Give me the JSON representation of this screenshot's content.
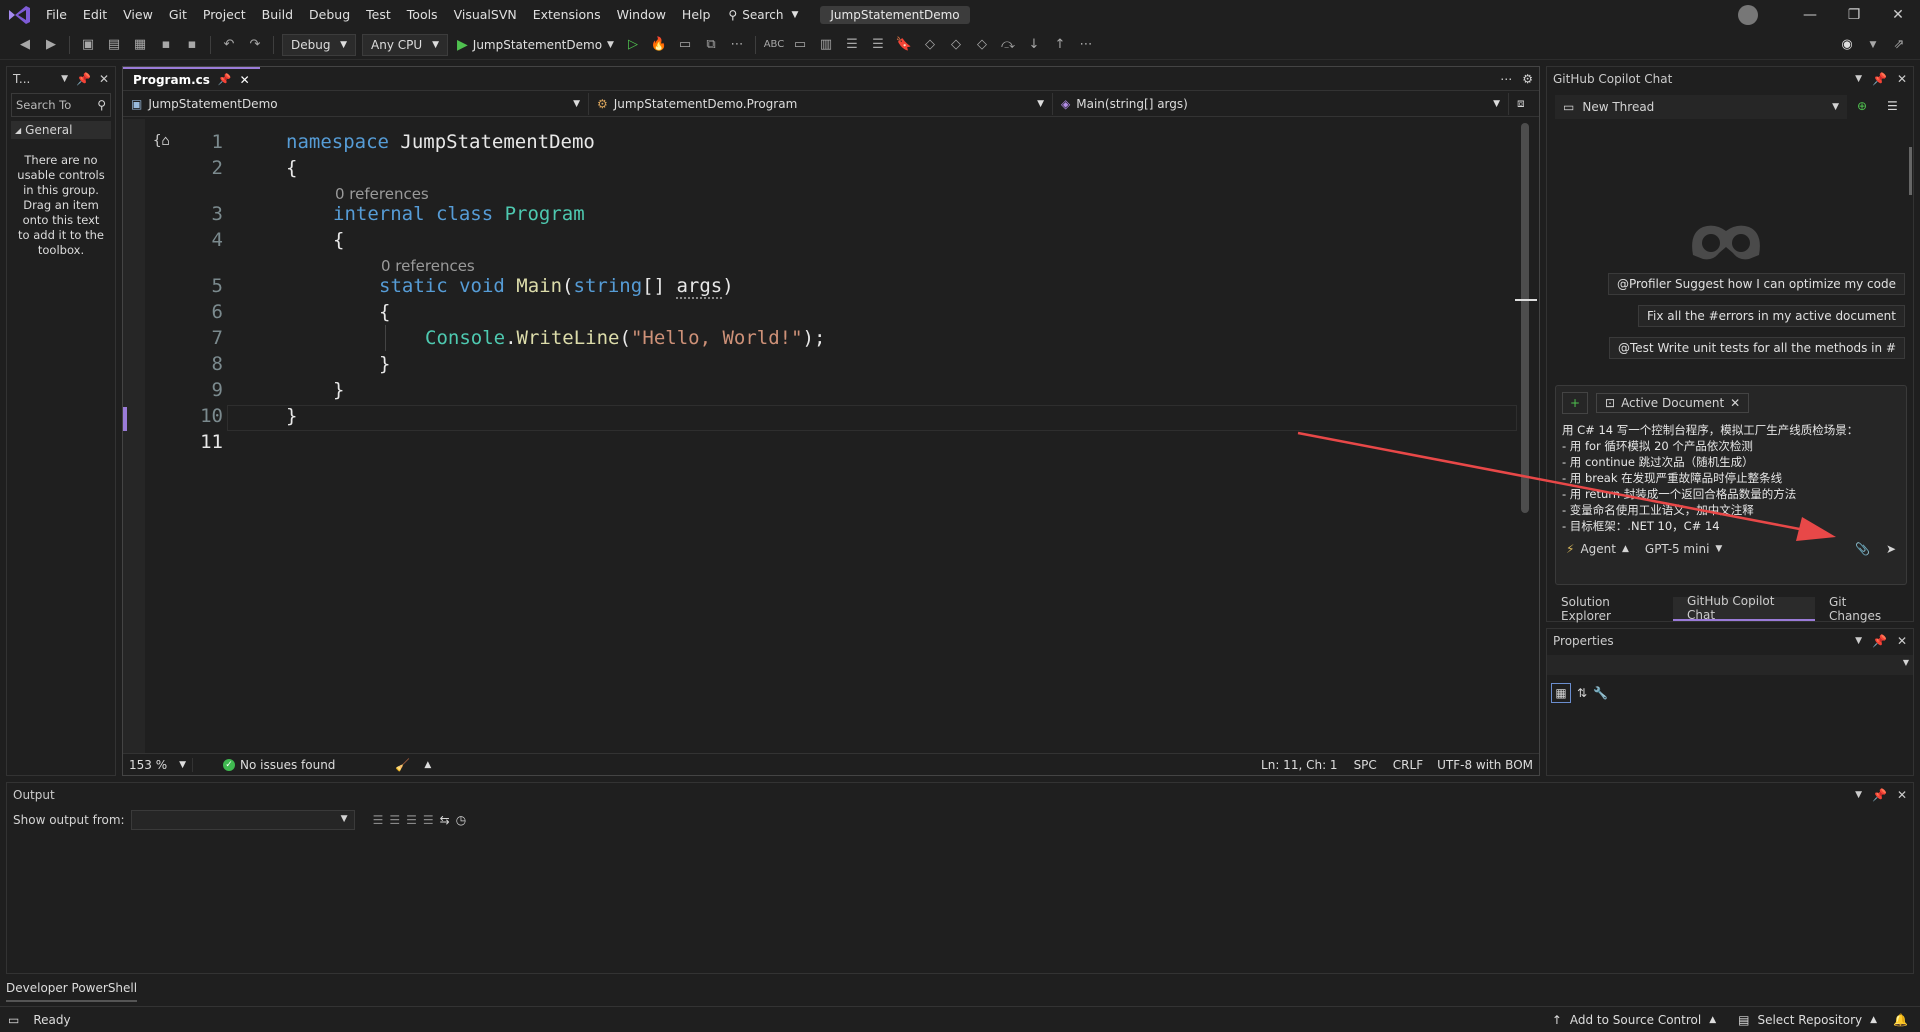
{
  "menu": {
    "items": [
      "File",
      "Edit",
      "View",
      "Git",
      "Project",
      "Build",
      "Debug",
      "Test",
      "Tools",
      "VisualSVN",
      "Extensions",
      "Window",
      "Help"
    ],
    "search": "Search",
    "solution": "JumpStatementDemo"
  },
  "toolbar": {
    "config": "Debug",
    "platform": "Any CPU",
    "run_target": "JumpStatementDemo"
  },
  "toolbox": {
    "title": "T...",
    "search_placeholder": "Search To",
    "group": "General",
    "empty_text": "There are no usable controls in this group. Drag an item onto this text to add it to the toolbox."
  },
  "editor": {
    "tab": "Program.cs",
    "nav": {
      "project": "JumpStatementDemo",
      "class": "JumpStatementDemo.Program",
      "member": "Main(string[] args)"
    },
    "refs_label": "0 references",
    "lines": [
      "1",
      "2",
      "3",
      "4",
      "5",
      "6",
      "7",
      "8",
      "9",
      "10",
      "11"
    ],
    "code": {
      "l1_kw": "namespace",
      "l1_name": " JumpStatementDemo",
      "l2": "{",
      "l3_kw": "internal class",
      "l3_ty": " Program",
      "l4": "{",
      "l5_kw1": "static void",
      "l5_fn": " Main",
      "l5_p1": "(",
      "l5_kw2": "string",
      "l5_p2": "[] ",
      "l5_arg": "args",
      "l5_p3": ")",
      "l6": "{",
      "l7_ty": "Console",
      "l7_p1": ".",
      "l7_fn": "WriteLine",
      "l7_p2": "(",
      "l7_st": "\"Hello, World!\"",
      "l7_p3": ");",
      "l8": "}",
      "l9": "}",
      "l10": "}"
    },
    "status": {
      "zoom": "153 %",
      "issues": "No issues found",
      "position": "Ln: 11, Ch: 1",
      "whitespace": "SPC",
      "line_ending": "CRLF",
      "encoding": "UTF-8 with BOM"
    }
  },
  "copilot": {
    "title": "GitHub Copilot Chat",
    "thread": "New Thread",
    "suggestions": [
      "@Profiler Suggest how I can optimize my code",
      "Fix all the #errors in my active document",
      "@Test Write unit tests for all the methods in #"
    ],
    "context_chip": "Active Document",
    "prompt_lines": [
      "用 C# 14 写一个控制台程序，模拟工厂生产线质检场景：",
      "- 用 for 循环模拟 20 个产品依次检测",
      "- 用 continue 跳过次品（随机生成）",
      "- 用 break 在发现严重故障品时停止整条线",
      "- 用 return 封装成一个返回合格品数量的方法",
      "- 变量命名使用工业语义，加中文注释",
      "- 目标框架：.NET 10，C# 14"
    ],
    "mode": "Agent",
    "model": "GPT-5 mini",
    "bottom_tabs": [
      "Solution Explorer",
      "GitHub Copilot Chat",
      "Git Changes"
    ]
  },
  "properties": {
    "title": "Properties"
  },
  "output": {
    "title": "Output",
    "show_from": "Show output from:"
  },
  "powershell": "Developer PowerShell",
  "statusbar": {
    "ready": "Ready",
    "source_control": "Add to Source Control",
    "repository": "Select Repository"
  },
  "colors": {
    "accent": "#9a7bd8",
    "keyword": "#569cd6",
    "type": "#4ec9b0",
    "method": "#dcdcaa",
    "string": "#ce9178",
    "arrow": "#e84848"
  }
}
